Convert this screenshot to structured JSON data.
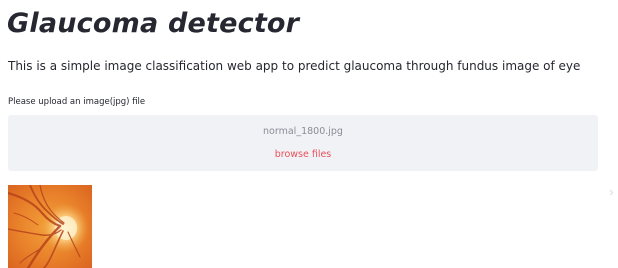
{
  "header": {
    "title": "Glaucoma detector",
    "description": "This is a simple image classification web app to predict glaucoma through fundus image of eye"
  },
  "uploader": {
    "label": "Please upload an image(jpg) file",
    "file_name": "normal_1800.jpg",
    "browse_label": "browse files"
  },
  "colors": {
    "text": "#262730",
    "dropzone_bg": "#f0f2f6",
    "file_name": "#8a8d96",
    "link": "#e8505b"
  },
  "preview": {
    "icon": "fundus-image"
  }
}
